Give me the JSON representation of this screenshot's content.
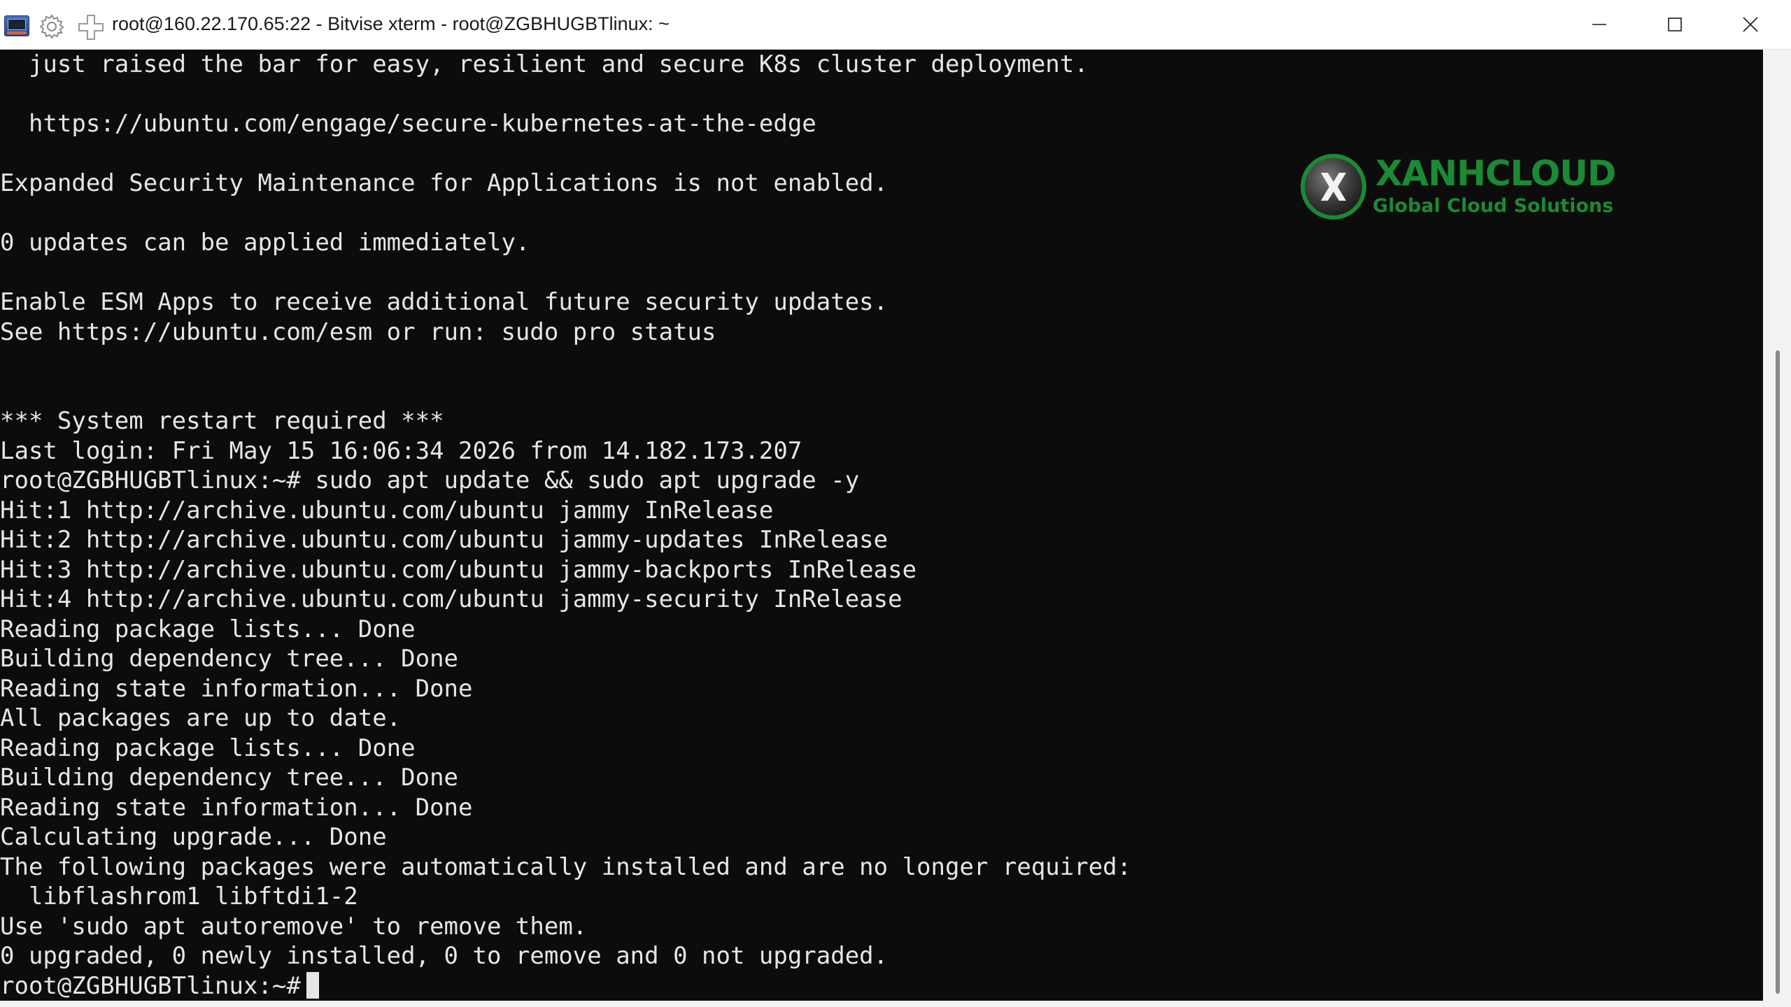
{
  "window": {
    "title": "root@160.22.170.65:22 - Bitvise xterm - root@ZGBHUGBTlinux: ~",
    "controls": {
      "minimize": "minimize",
      "maximize": "maximize",
      "close": "close"
    }
  },
  "terminal": {
    "lines": [
      "  just raised the bar for easy, resilient and secure K8s cluster deployment.",
      "",
      "  https://ubuntu.com/engage/secure-kubernetes-at-the-edge",
      "",
      "Expanded Security Maintenance for Applications is not enabled.",
      "",
      "0 updates can be applied immediately.",
      "",
      "Enable ESM Apps to receive additional future security updates.",
      "See https://ubuntu.com/esm or run: sudo pro status",
      "",
      "",
      "*** System restart required ***",
      "Last login: Fri May 15 16:06:34 2026 from 14.182.173.207",
      "root@ZGBHUGBTlinux:~# sudo apt update && sudo apt upgrade -y",
      "Hit:1 http://archive.ubuntu.com/ubuntu jammy InRelease",
      "Hit:2 http://archive.ubuntu.com/ubuntu jammy-updates InRelease",
      "Hit:3 http://archive.ubuntu.com/ubuntu jammy-backports InRelease",
      "Hit:4 http://archive.ubuntu.com/ubuntu jammy-security InRelease",
      "Reading package lists... Done",
      "Building dependency tree... Done",
      "Reading state information... Done",
      "All packages are up to date.",
      "Reading package lists... Done",
      "Building dependency tree... Done",
      "Reading state information... Done",
      "Calculating upgrade... Done",
      "The following packages were automatically installed and are no longer required:",
      "  libflashrom1 libftdi1-2",
      "Use 'sudo apt autoremove' to remove them.",
      "0 upgraded, 0 newly installed, 0 to remove and 0 not upgraded."
    ],
    "prompt": "root@ZGBHUGBTlinux:~#"
  },
  "logo": {
    "name": "XANHCLOUD",
    "tagline": "Global Cloud Solutions",
    "brand_color": "#1a8a34"
  },
  "colors": {
    "terminal_bg": "#0c0c0c",
    "terminal_fg": "#e6e6e6",
    "titlebar_bg": "#ffffff"
  }
}
